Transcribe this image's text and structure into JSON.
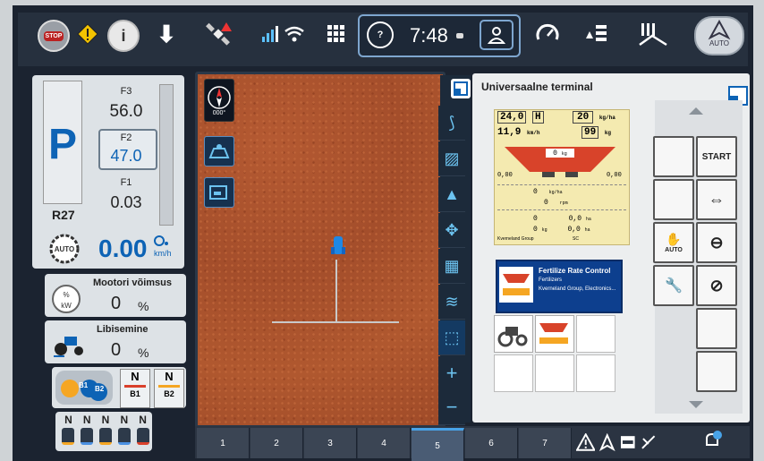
{
  "topbar": {
    "stop_label": "STOP",
    "time": "7:48",
    "auto_label": "AUTO",
    "help_label": "?"
  },
  "left": {
    "gear": "P",
    "range": "R27",
    "f3_label": "F3",
    "f3_value": "56.0",
    "f2_label": "F2",
    "f2_value": "47.0",
    "f1_label": "F1",
    "f1_value": "0.03",
    "speed": "0.00",
    "speed_unit": "km/h",
    "auto_icon_label": "AUTO",
    "engine_power_label": "Mootori võimsus",
    "engine_power_value": "0",
    "engine_power_unit": "%",
    "kw_label": "kW",
    "slip_label": "Libisemine",
    "slip_value": "0",
    "slip_unit": "%",
    "b1_label": "B1",
    "b2_label": "B2",
    "n1": "N",
    "n2": "N",
    "n_row": [
      "N",
      "N",
      "N",
      "N",
      "N"
    ]
  },
  "map": {
    "compass_heading": "000°"
  },
  "ut": {
    "title": "Universaalne terminal",
    "panel": {
      "width_value": "24,0",
      "width_unit": "H",
      "rate_value": "20",
      "rate_unit": "kg/ha",
      "speed_value": "11,9",
      "speed_unit": "km/h",
      "rate2_value": "99",
      "rate2_unit": "kg",
      "hopper_value": "0",
      "hopper_unit": "kg",
      "left_value": "0,00",
      "right_value": "0,00",
      "row1_val": "0",
      "row1_unit": "kg/ha",
      "row2_val": "0",
      "row2_unit": "rpm",
      "row3_a": "0",
      "row3_b": "0,0",
      "row3_b_unit": "ha",
      "row4_a": "0",
      "row4_a_unit": "kg",
      "row4_b": "0,0",
      "row4_b_unit": "ha",
      "footer_left": "Kverneland Group",
      "footer_right": "SC"
    },
    "app_card": {
      "title": "Fertilize Rate Control",
      "subtitle": "Fertilizers",
      "vendor": "Kverneland Group, Electronics..."
    },
    "softkeys": {
      "start": "START",
      "auto": "AUTO"
    }
  },
  "pages": [
    "1",
    "2",
    "3",
    "4",
    "5",
    "6",
    "7"
  ],
  "colors": {
    "accent_blue": "#0d63b5",
    "field_brown": "#a8522c",
    "panel_yellow": "#f4eab0",
    "spreader_red": "#d8432a"
  }
}
